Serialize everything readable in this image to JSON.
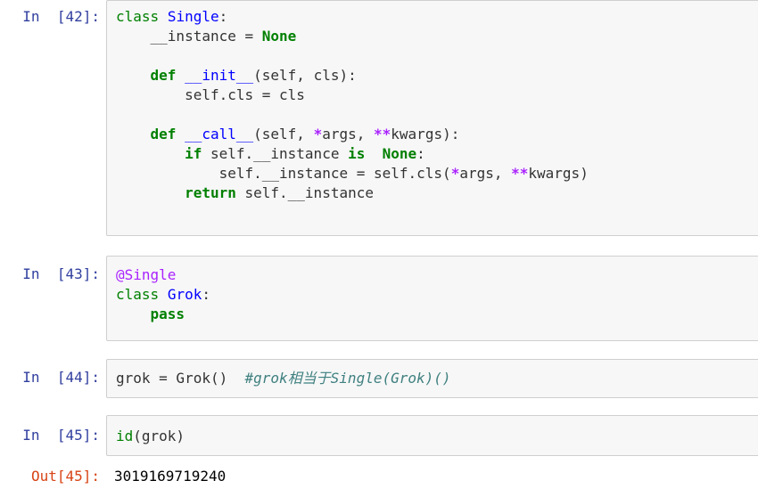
{
  "cells": [
    {
      "prompt": "In  [42]:",
      "lines": [
        {
          "indent": "",
          "parts": [
            [
              "kw-plain",
              "class"
            ],
            [
              "sp",
              " "
            ],
            [
              "cls",
              "Single"
            ],
            [
              "t",
              ":"
            ]
          ]
        },
        {
          "indent": "    ",
          "parts": [
            [
              "t",
              "__instance = "
            ],
            [
              "kw",
              "None"
            ]
          ]
        },
        {
          "indent": "",
          "parts": []
        },
        {
          "indent": "    ",
          "parts": [
            [
              "kw",
              "def"
            ],
            [
              "sp",
              " "
            ],
            [
              "fn",
              "__init__"
            ],
            [
              "t",
              "(self, cls):"
            ]
          ]
        },
        {
          "indent": "        ",
          "parts": [
            [
              "t",
              "self.cls = cls"
            ]
          ]
        },
        {
          "indent": "",
          "parts": []
        },
        {
          "indent": "    ",
          "parts": [
            [
              "kw",
              "def"
            ],
            [
              "sp",
              " "
            ],
            [
              "fn",
              "__call__"
            ],
            [
              "t",
              "(self, "
            ],
            [
              "op",
              "*"
            ],
            [
              "t",
              "args, "
            ],
            [
              "op",
              "**"
            ],
            [
              "t",
              "kwargs):"
            ]
          ]
        },
        {
          "indent": "        ",
          "parts": [
            [
              "kw",
              "if"
            ],
            [
              "t",
              " self.__instance "
            ],
            [
              "kw",
              "is"
            ],
            [
              "t",
              "  "
            ],
            [
              "kw",
              "None"
            ],
            [
              "t",
              ":"
            ]
          ]
        },
        {
          "indent": "            ",
          "parts": [
            [
              "t",
              "self.__instance = self.cls("
            ],
            [
              "op",
              "*"
            ],
            [
              "t",
              "args, "
            ],
            [
              "op",
              "**"
            ],
            [
              "t",
              "kwargs)"
            ]
          ]
        },
        {
          "indent": "        ",
          "parts": [
            [
              "kw",
              "return"
            ],
            [
              "t",
              " self.__instance"
            ]
          ]
        }
      ]
    },
    {
      "prompt": "In  [43]:",
      "lines": [
        {
          "indent": "",
          "parts": [
            [
              "dec",
              "@Single"
            ]
          ]
        },
        {
          "indent": "",
          "parts": [
            [
              "kw-plain",
              "class"
            ],
            [
              "sp",
              " "
            ],
            [
              "cls",
              "Grok"
            ],
            [
              "t",
              ":"
            ]
          ]
        },
        {
          "indent": "    ",
          "parts": [
            [
              "kw",
              "pass"
            ]
          ]
        }
      ]
    },
    {
      "prompt": "In  [44]:",
      "lines": [
        {
          "indent": "",
          "parts": [
            [
              "t",
              "grok = Grok()  "
            ],
            [
              "cm",
              "#grok相当于Single(Grok)()"
            ]
          ]
        }
      ]
    },
    {
      "prompt": "In  [45]:",
      "lines": [
        {
          "indent": "",
          "parts": [
            [
              "bi",
              "id"
            ],
            [
              "t",
              "(grok)"
            ]
          ]
        }
      ]
    }
  ],
  "output": {
    "prompt": "Out[45]:",
    "text": "3019169719240"
  },
  "colors": {
    "prompt_in": "#303f9f",
    "prompt_out": "#d84315",
    "keyword": "#008000",
    "class_name": "#0000ff",
    "operator": "#aa22ff",
    "comment": "#408080",
    "cell_bg": "#f7f7f7",
    "cell_border": "#cfcfcf"
  }
}
